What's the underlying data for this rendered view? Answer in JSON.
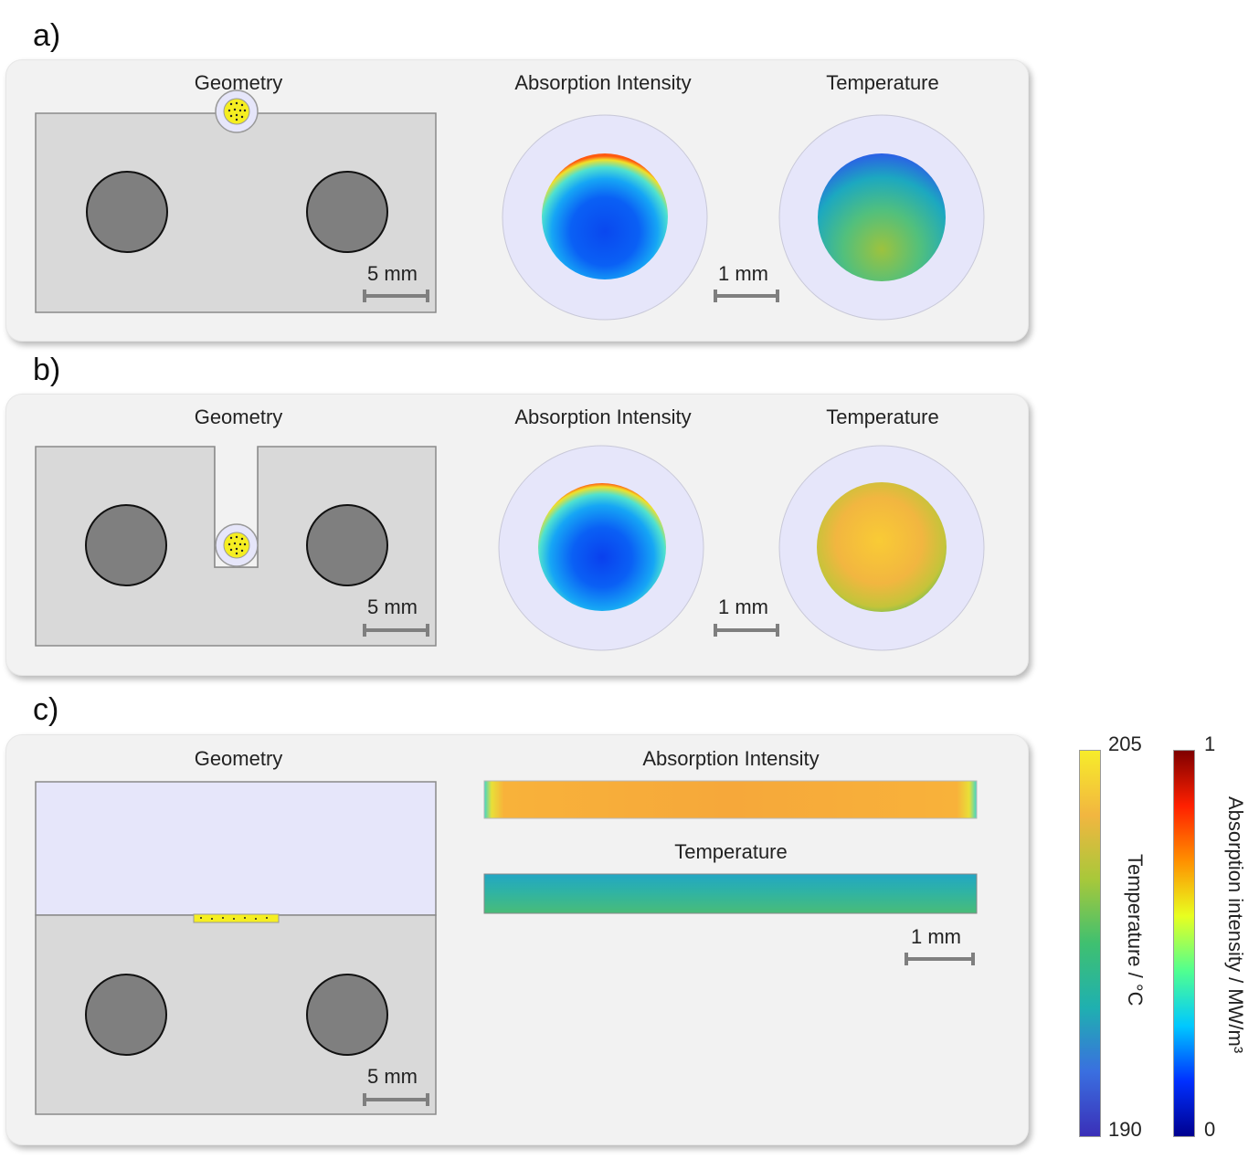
{
  "panels": [
    {
      "label": "a)",
      "geometry_title": "Geometry",
      "absorption_title": "Absorption Intensity",
      "temperature_title": "Temperature",
      "scale_large": "5 mm",
      "scale_small": "1 mm"
    },
    {
      "label": "b)",
      "geometry_title": "Geometry",
      "absorption_title": "Absorption Intensity",
      "temperature_title": "Temperature",
      "scale_large": "5 mm",
      "scale_small": "1 mm"
    },
    {
      "label": "c)",
      "geometry_title": "Geometry",
      "absorption_title": "Absorption Intensity",
      "temperature_title": "Temperature",
      "scale_large": "5 mm",
      "scale_small": "1 mm"
    }
  ],
  "colorbars": {
    "temperature": {
      "max": "205",
      "min": "190",
      "label": "Temperature / °C",
      "colors": [
        "#3a2fb8",
        "#3a6fe0",
        "#1fb0b0",
        "#3fc070",
        "#a8c83a",
        "#f2b640",
        "#f7ec2a"
      ]
    },
    "absorption": {
      "max": "1",
      "min": "0",
      "label": "Absorption intensity / MW/m³",
      "colors": [
        "#00008f",
        "#0030ff",
        "#00c8ff",
        "#50ff90",
        "#e8ff20",
        "#ff9000",
        "#ff2000",
        "#7f0000"
      ]
    }
  },
  "colors": {
    "block": "#d9d9d9",
    "rod": "#7f7f7f",
    "tube": "#e6e6fa",
    "sample": "#f5ee22"
  }
}
